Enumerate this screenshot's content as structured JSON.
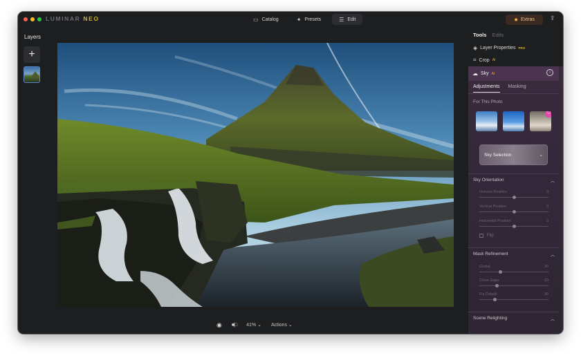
{
  "app": {
    "logo_main": "LUMINAR ",
    "logo_accent": "NEO"
  },
  "top_tabs": [
    {
      "label": "Catalog",
      "icon": "folder-icon"
    },
    {
      "label": "Presets",
      "icon": "sparkle-icon"
    },
    {
      "label": "Edit",
      "icon": "sliders-icon"
    }
  ],
  "extras": {
    "label": "Extras"
  },
  "layers": {
    "title": "Layers",
    "add_symbol": "+"
  },
  "bottom_bar": {
    "zoom": "41%",
    "actions": "Actions"
  },
  "right_panel": {
    "tabs": [
      {
        "label": "Tools"
      },
      {
        "label": "Edits"
      }
    ],
    "tools": [
      {
        "label": "Layer Properties",
        "badge": "PRO"
      },
      {
        "label": "Crop",
        "badge": "AI"
      }
    ],
    "sky": {
      "title": "Sky",
      "badge": "AI",
      "subtabs": [
        {
          "label": "Adjustments"
        },
        {
          "label": "Masking"
        }
      ],
      "for_this_photo": "For This Photo",
      "selection_label": "Sky Selection",
      "orientation": {
        "title": "Sky Orientation",
        "sliders": [
          {
            "name": "Horizon Position",
            "value": "0",
            "level": 0.5
          },
          {
            "name": "Vertical Position",
            "value": "0",
            "level": 0.5
          },
          {
            "name": "Horizontal Position",
            "value": "0",
            "level": 0.5
          }
        ],
        "flip_label": "Flip"
      },
      "mask_refinement": {
        "title": "Mask Refinement",
        "sliders": [
          {
            "name": "Global",
            "value": "30",
            "level": 0.3
          },
          {
            "name": "Close Gaps",
            "value": "10",
            "level": 0.25
          },
          {
            "name": "Fix Details",
            "value": "30",
            "level": 0.22
          }
        ]
      },
      "scene_relighting": {
        "title": "Scene Relighting"
      }
    }
  },
  "colors": {
    "window_bg": "#1d1e20",
    "accent_gold": "#d0b02e",
    "sky_panel": "#3a2a3c",
    "extras_text": "#f0b14a"
  }
}
